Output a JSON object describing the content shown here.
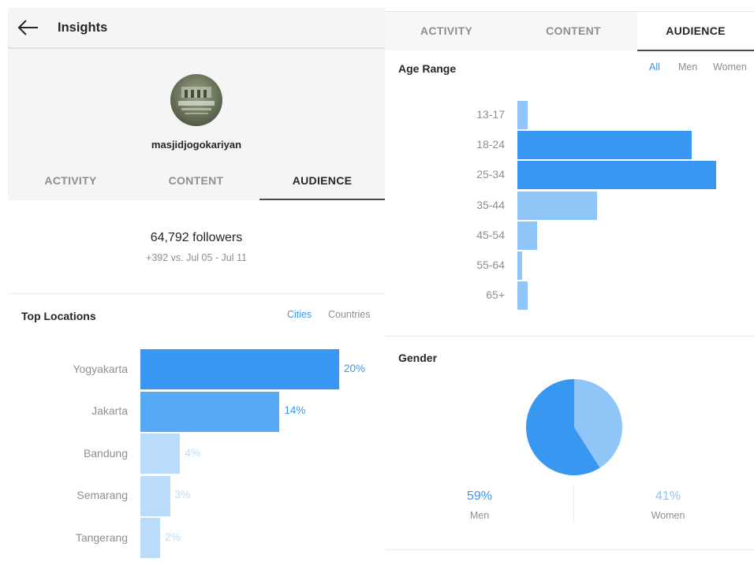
{
  "colors": {
    "accent": "#3897f0",
    "bar_dark": "#3897f0",
    "bar_mid": "#56a9f4",
    "bar_light": "#b9dcfb",
    "pie_men": "#3897f0",
    "pie_women": "#8fc5f7"
  },
  "left_panel": {
    "header": {
      "back_icon": "arrow-left-icon",
      "title": "Insights"
    },
    "profile": {
      "username": "masjidjogokariyan"
    },
    "tabs": [
      {
        "label": "ACTIVITY",
        "active": false
      },
      {
        "label": "CONTENT",
        "active": false
      },
      {
        "label": "AUDIENCE",
        "active": true
      }
    ],
    "followers": {
      "count_text": "64,792 followers",
      "growth_text": "+392 vs. Jul 05 - Jul 11"
    },
    "top_locations": {
      "title": "Top Locations",
      "toggles": [
        {
          "label": "Cities",
          "active": true
        },
        {
          "label": "Countries",
          "active": false
        }
      ],
      "items": [
        {
          "name": "Yogyakarta",
          "percent": 20,
          "label": "20%",
          "shade": "dark"
        },
        {
          "name": "Jakarta",
          "percent": 14,
          "label": "14%",
          "shade": "mid"
        },
        {
          "name": "Bandung",
          "percent": 4,
          "label": "4%",
          "shade": "light"
        },
        {
          "name": "Semarang",
          "percent": 3,
          "label": "3%",
          "shade": "light"
        },
        {
          "name": "Tangerang",
          "percent": 2,
          "label": "2%",
          "shade": "light"
        }
      ]
    }
  },
  "right_panel": {
    "tabs": [
      {
        "label": "ACTIVITY",
        "active": false
      },
      {
        "label": "CONTENT",
        "active": false
      },
      {
        "label": "AUDIENCE",
        "active": true
      }
    ],
    "age_range": {
      "title": "Age Range",
      "toggles": [
        {
          "label": "All",
          "active": true
        },
        {
          "label": "Men",
          "active": false
        },
        {
          "label": "Women",
          "active": false
        }
      ],
      "items": [
        {
          "range": "13-17",
          "value": 2,
          "shade": "light"
        },
        {
          "range": "18-24",
          "value": 35,
          "shade": "dark"
        },
        {
          "range": "25-34",
          "value": 40,
          "shade": "dark"
        },
        {
          "range": "35-44",
          "value": 16,
          "shade": "light"
        },
        {
          "range": "45-54",
          "value": 4,
          "shade": "light"
        },
        {
          "range": "55-64",
          "value": 1,
          "shade": "light"
        },
        {
          "range": "65+",
          "value": 2,
          "shade": "light"
        }
      ]
    },
    "gender": {
      "title": "Gender",
      "men": {
        "label": "Men",
        "value_text": "59%",
        "percent": 59
      },
      "women": {
        "label": "Women",
        "value_text": "41%",
        "percent": 41
      }
    }
  }
}
